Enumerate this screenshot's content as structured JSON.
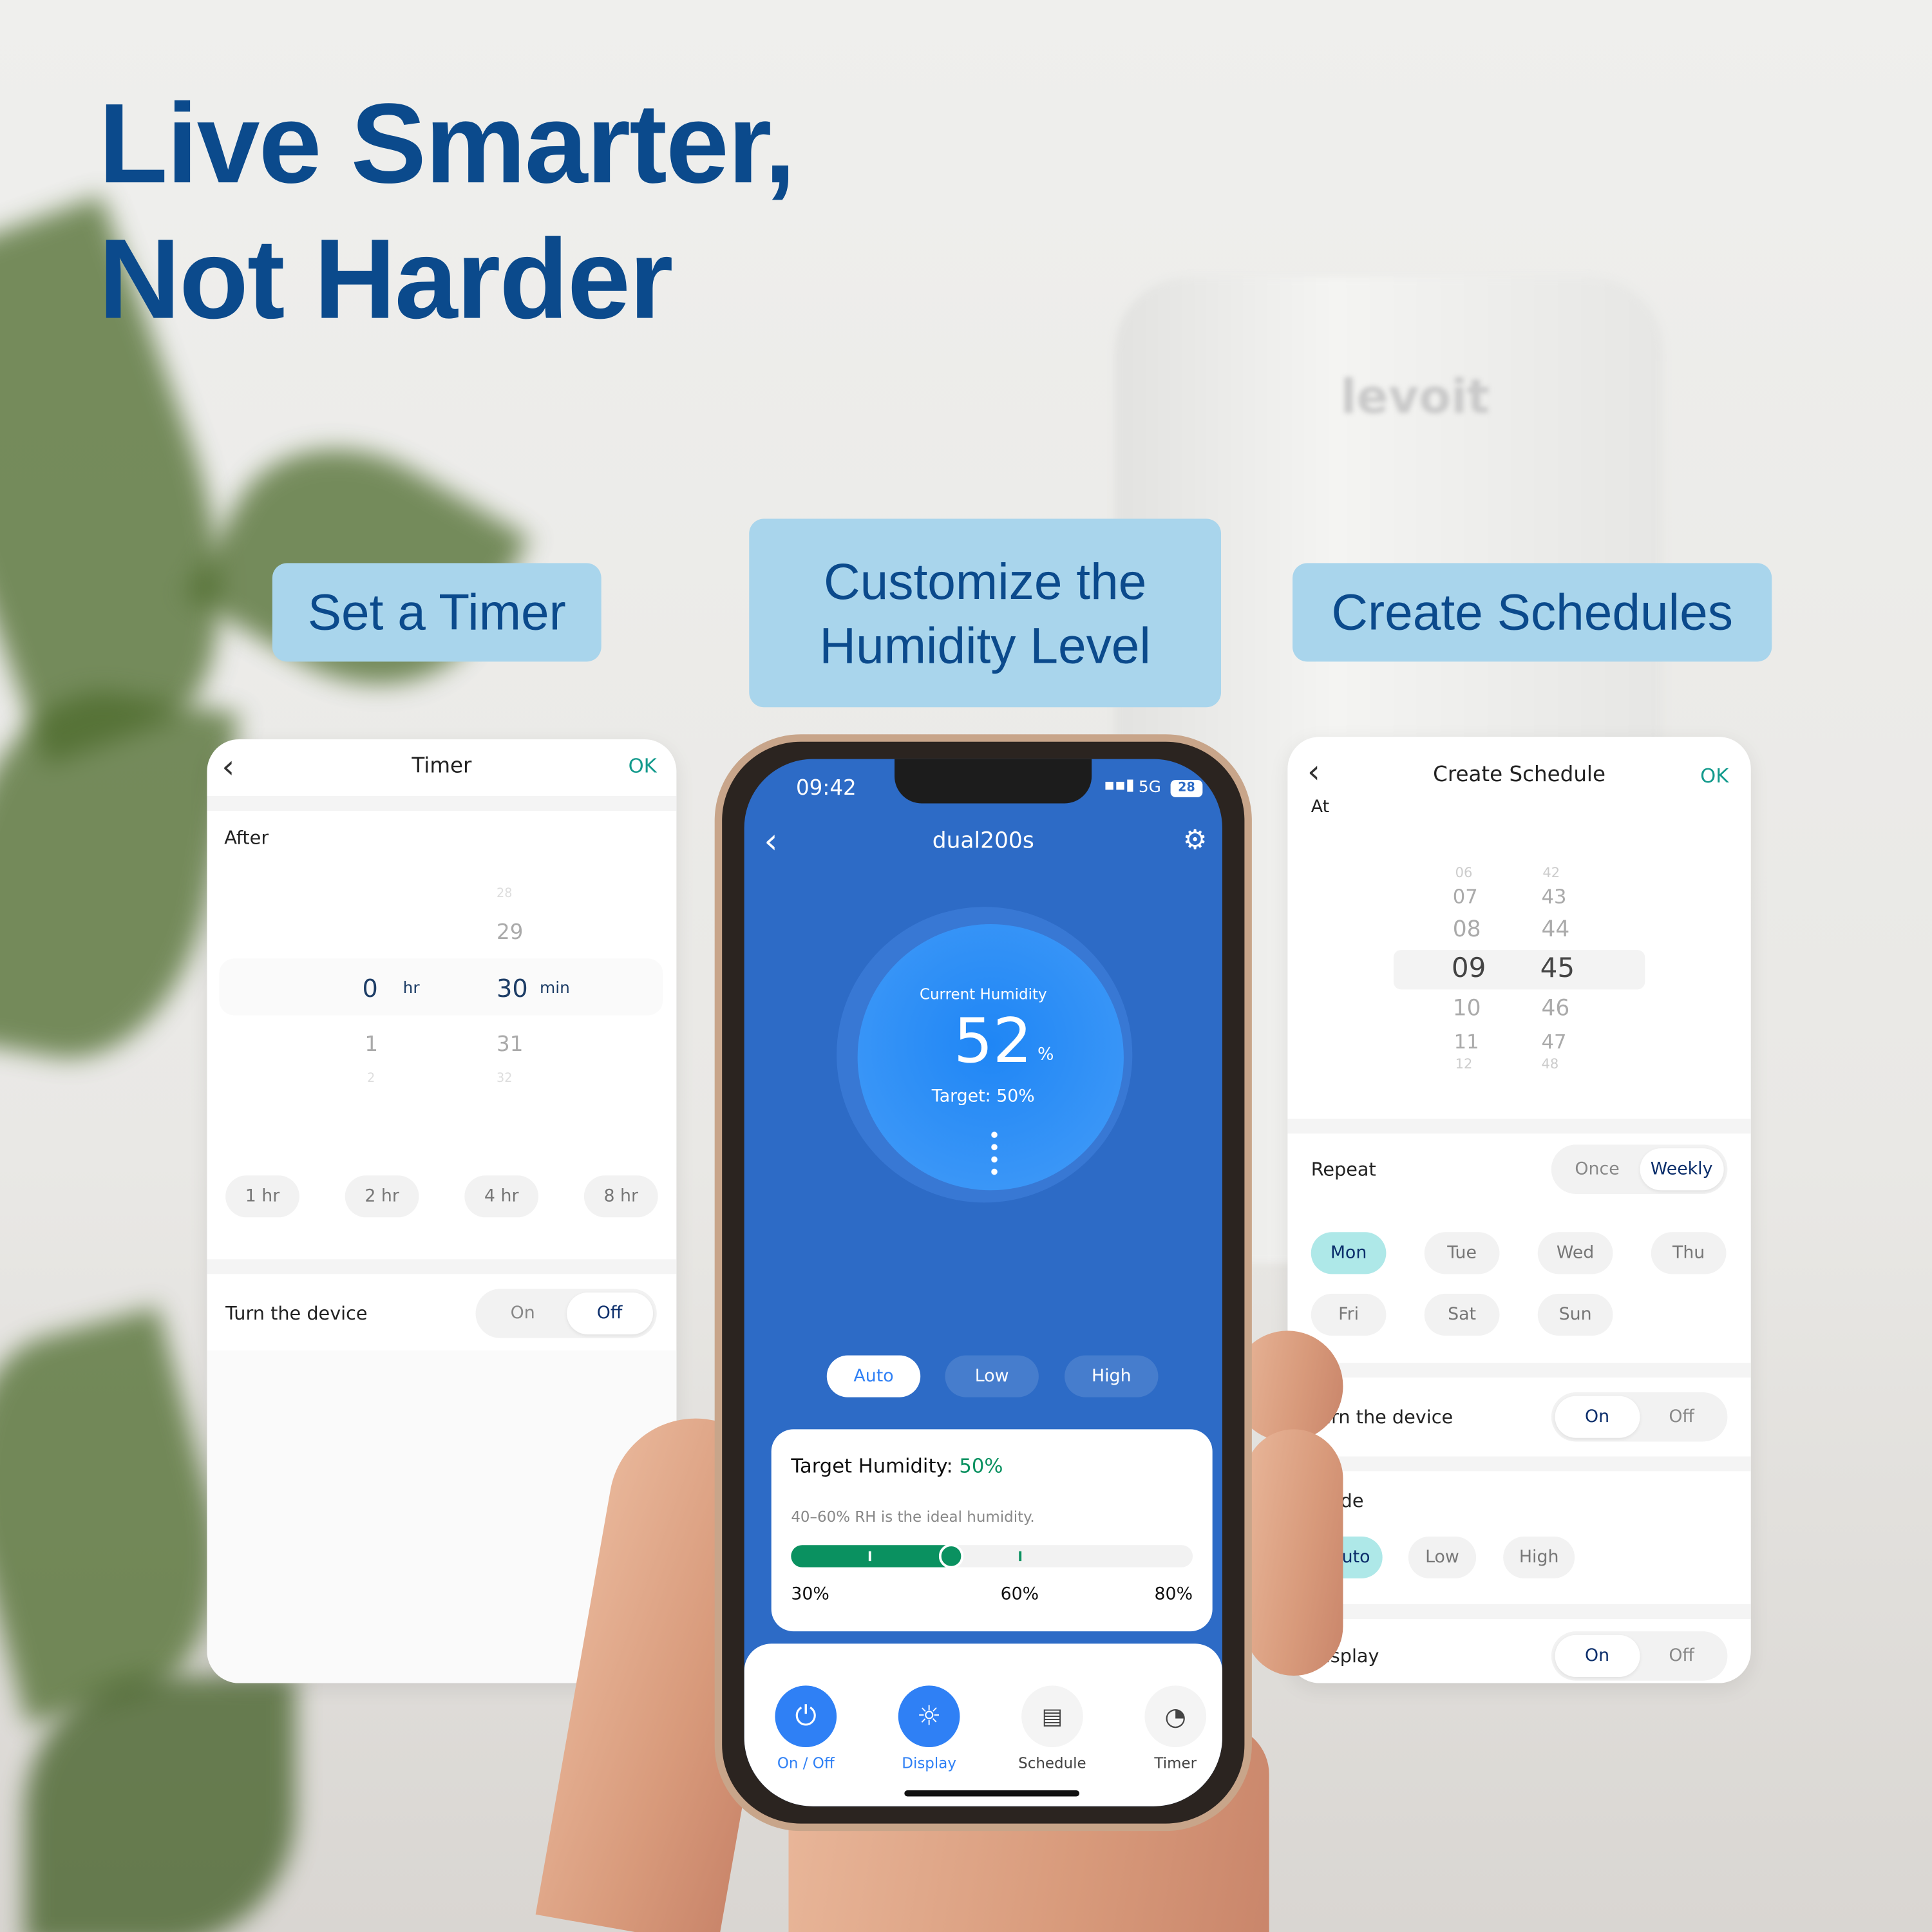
{
  "headline": {
    "line1": "Live Smarter,",
    "line2": "Not Harder"
  },
  "background_brand": "levoit",
  "tags": {
    "timer": "Set a Timer",
    "humidity_l1": "Customize the",
    "humidity_l2": "Humidity Level",
    "schedule": "Create Schedules"
  },
  "timer_screen": {
    "title": "Timer",
    "ok": "OK",
    "after_label": "After",
    "hours": {
      "selected": "0",
      "unit": "hr",
      "below": [
        "1",
        "2"
      ]
    },
    "minutes": {
      "above": [
        "28",
        "29"
      ],
      "selected": "30",
      "unit": "min",
      "below": [
        "31",
        "32"
      ]
    },
    "presets": [
      "1 hr",
      "2 hr",
      "4 hr",
      "8 hr"
    ],
    "turn_device": {
      "label": "Turn the device",
      "options": [
        "On",
        "Off"
      ],
      "selected": "Off"
    }
  },
  "phone": {
    "status": {
      "time": "09:42",
      "network": "5G",
      "battery": "28"
    },
    "device_name": "dual200s",
    "current_label": "Current Humidity",
    "current_value": "52",
    "current_unit": "%",
    "target_text": "Target: 50%",
    "modes": [
      "Auto",
      "Low",
      "High"
    ],
    "selected_mode": "Auto",
    "target_card": {
      "label": "Target Humidity:",
      "value": "50%",
      "hint": "40–60% RH is the ideal humidity.",
      "slider_percent": 50,
      "scale": [
        "30%",
        "60%",
        "80%"
      ]
    },
    "nav": [
      {
        "label": "On / Off",
        "icon": "power-icon",
        "active": true
      },
      {
        "label": "Display",
        "icon": "sun-icon",
        "active": true
      },
      {
        "label": "Schedule",
        "icon": "calendar-icon",
        "active": false
      },
      {
        "label": "Timer",
        "icon": "timer-icon",
        "active": false
      }
    ]
  },
  "schedule_screen": {
    "title": "Create Schedule",
    "ok": "OK",
    "at_label": "At",
    "hours": {
      "above": [
        "06",
        "07",
        "08"
      ],
      "selected": "09",
      "below": [
        "10",
        "11",
        "12"
      ]
    },
    "minutes": {
      "above": [
        "42",
        "43",
        "44"
      ],
      "selected": "45",
      "below": [
        "46",
        "47",
        "48"
      ]
    },
    "repeat": {
      "label": "Repeat",
      "options": [
        "Once",
        "Weekly"
      ],
      "selected": "Weekly"
    },
    "days": [
      "Mon",
      "Tue",
      "Wed",
      "Thu",
      "Fri",
      "Sat",
      "Sun"
    ],
    "selected_day": "Mon",
    "turn_device": {
      "label": "Turn the device",
      "options": [
        "On",
        "Off"
      ],
      "selected": "On"
    },
    "mode": {
      "label_partial": "de",
      "options": [
        "Auto",
        "Low",
        "High"
      ],
      "selected": "Auto",
      "auto_partial": "uto"
    },
    "display": {
      "label": "Display",
      "options": [
        "On",
        "Off"
      ],
      "selected": "On"
    }
  },
  "colors": {
    "brand_blue": "#0b4a8c",
    "tag_bg": "#a9d5ec",
    "teal_ok": "#139a8c",
    "app_blue": "#2d6bc6",
    "accent_blue": "#2f80f5",
    "green": "#0a9160",
    "day_selected": "#aee8e8"
  }
}
